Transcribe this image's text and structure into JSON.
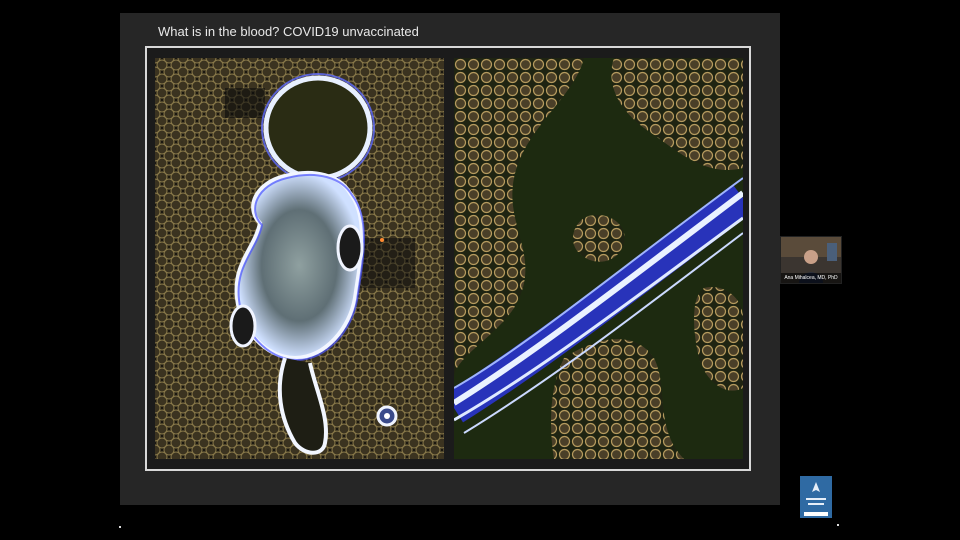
{
  "slide": {
    "title": "What is in the blood? COVID19 unvaccinated"
  },
  "speaker": {
    "caption": "Ana Mihalcea, MD, PhD"
  },
  "icons": {
    "logo": "organization-logo-icon"
  }
}
